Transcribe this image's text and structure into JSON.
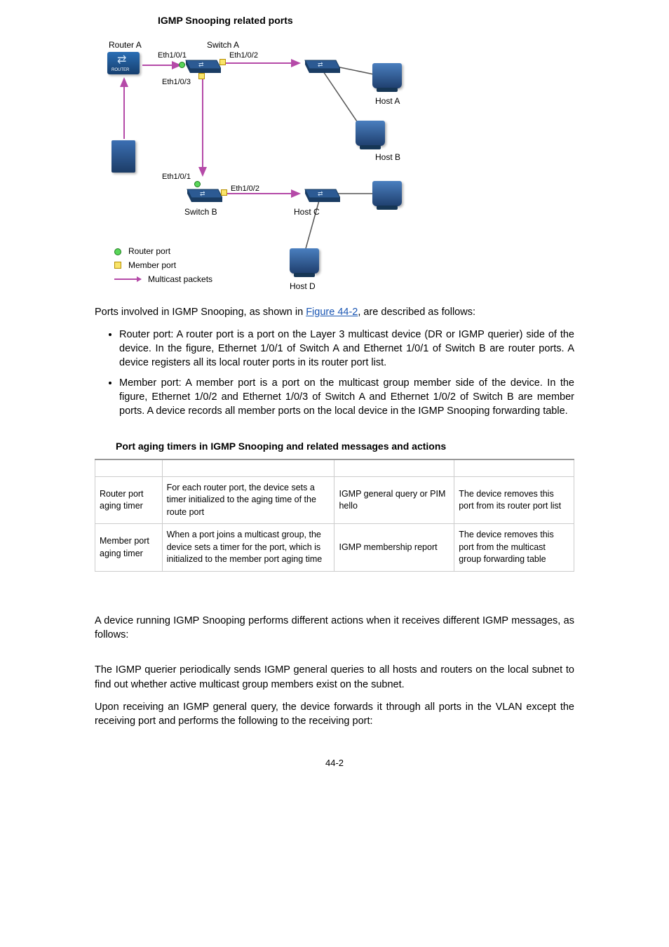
{
  "figure": {
    "title": "IGMP Snooping related ports",
    "labels": {
      "routerA": "Router A",
      "switchA": "Switch A",
      "switchB": "Switch B",
      "hostA": "Host A",
      "hostB": "Host B",
      "hostC": "Host C",
      "hostD": "Host D",
      "eth101_a": "Eth1/0/1",
      "eth102_a": "Eth1/0/2",
      "eth103_a": "Eth1/0/3",
      "eth101_b": "Eth1/0/1",
      "eth102_b": "Eth1/0/2"
    },
    "legend": {
      "router_port": "Router port",
      "member_port": "Member port",
      "multicast": "Multicast packets"
    }
  },
  "para1_prefix": "Ports involved in IGMP Snooping, as shown in ",
  "para1_link": "Figure 44-2",
  "para1_suffix": ", are described as follows:",
  "bullets": [
    "Router port: A router port is a port on the Layer 3 multicast device (DR or IGMP querier) side of the device. In the figure, Ethernet 1/0/1 of Switch A and Ethernet 1/0/1 of Switch B are router ports. A device registers all its local router ports in its router port list.",
    "Member port: A member port is a port on the multicast group member side of the device. In the figure, Ethernet 1/0/2 and Ethernet 1/0/3 of Switch A and Ethernet 1/0/2 of Switch B are member ports. A device records all member ports on the local device in the IGMP Snooping forwarding table."
  ],
  "table": {
    "title": "Port aging timers in IGMP Snooping and related messages and actions",
    "rows": [
      {
        "c1": "Router port aging timer",
        "c2": "For each router port, the device sets a timer initialized to the aging time of the route port",
        "c3": "IGMP general query or PIM hello",
        "c4": "The device removes this port from its router port list"
      },
      {
        "c1": "Member port aging timer",
        "c2": "When a port joins a multicast group, the device sets a timer for the port, which is initialized to the member port aging time",
        "c3": "IGMP membership report",
        "c4": "The device removes this port from the multicast group forwarding table"
      }
    ]
  },
  "para2": "A device running IGMP Snooping performs different actions when it receives different IGMP messages, as follows:",
  "para3": "The IGMP querier periodically sends IGMP general queries to all hosts and routers on the local subnet to find out whether active multicast group members exist on the subnet.",
  "para4": "Upon receiving an IGMP general query, the device forwards it through all ports in the VLAN except the receiving port and performs the following to the receiving port:",
  "page_num": "44-2",
  "chart_data": {
    "type": "diagram",
    "nodes": [
      {
        "id": "routerA",
        "type": "router",
        "label": "Router A"
      },
      {
        "id": "server",
        "type": "server"
      },
      {
        "id": "switchA",
        "type": "switch",
        "label": "Switch A",
        "ports": [
          {
            "name": "Eth1/0/1",
            "role": "router-port"
          },
          {
            "name": "Eth1/0/2",
            "role": "member-port"
          },
          {
            "name": "Eth1/0/3",
            "role": "member-port"
          }
        ]
      },
      {
        "id": "switchB",
        "type": "switch",
        "label": "Switch B",
        "ports": [
          {
            "name": "Eth1/0/1",
            "role": "router-port"
          },
          {
            "name": "Eth1/0/2",
            "role": "member-port"
          }
        ]
      },
      {
        "id": "switchC",
        "type": "switch"
      },
      {
        "id": "switchD",
        "type": "switch"
      },
      {
        "id": "hostA",
        "type": "host",
        "label": "Host A"
      },
      {
        "id": "hostB",
        "type": "host",
        "label": "Host B"
      },
      {
        "id": "hostC",
        "type": "host",
        "label": "Host C"
      },
      {
        "id": "hostD",
        "type": "host",
        "label": "Host D"
      }
    ],
    "edges": [
      {
        "from": "server",
        "to": "routerA",
        "style": "multicast"
      },
      {
        "from": "routerA",
        "to": "switchA:Eth1/0/1",
        "style": "multicast"
      },
      {
        "from": "switchA:Eth1/0/2",
        "to": "switchC",
        "style": "multicast"
      },
      {
        "from": "switchA:Eth1/0/3",
        "to": "switchB:Eth1/0/1",
        "style": "multicast"
      },
      {
        "from": "switchB:Eth1/0/2",
        "to": "switchD",
        "style": "multicast"
      },
      {
        "from": "switchC",
        "to": "hostA"
      },
      {
        "from": "switchC",
        "to": "hostB"
      },
      {
        "from": "switchD",
        "to": "hostC"
      },
      {
        "from": "switchD",
        "to": "hostD"
      }
    ],
    "legend": [
      {
        "symbol": "green-circle",
        "label": "Router port"
      },
      {
        "symbol": "yellow-square",
        "label": "Member port"
      },
      {
        "symbol": "magenta-arrow",
        "label": "Multicast packets"
      }
    ]
  }
}
